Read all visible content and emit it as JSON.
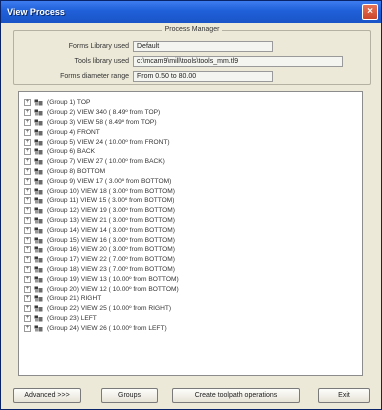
{
  "window": {
    "title": "View Process",
    "close_glyph": "×"
  },
  "manager": {
    "legend": "Process Manager",
    "fields": [
      {
        "label": "Forms Library used",
        "value": "Default"
      },
      {
        "label": "Tools library used",
        "value": "c:\\mcam9\\mill\\tools\\tools_mm.tl9"
      },
      {
        "label": "Forms diameter range",
        "value": "From 0.50 to 80.00"
      }
    ]
  },
  "tree": {
    "expander_glyph": "+",
    "items": [
      "(Group 1) TOP",
      "(Group 2) VIEW 340 ( 8.49º from TOP)",
      "(Group 3) VIEW 58 ( 8.49º from TOP)",
      "(Group 4) FRONT",
      "(Group 5) VIEW 24 ( 10.00º from FRONT)",
      "(Group 6) BACK",
      "(Group 7) VIEW 27 ( 10.00º from BACK)",
      "(Group 8) BOTTOM",
      "(Group 9) VIEW 17 ( 3.00º from BOTTOM)",
      "(Group 10) VIEW 18 ( 3.00º from BOTTOM)",
      "(Group 11) VIEW 15 ( 3.00º from BOTTOM)",
      "(Group 12) VIEW 19 ( 3.00º from BOTTOM)",
      "(Group 13) VIEW 21 ( 3.00º from BOTTOM)",
      "(Group 14) VIEW 14 ( 3.00º from BOTTOM)",
      "(Group 15) VIEW 16 ( 3.00º from BOTTOM)",
      "(Group 16) VIEW 20 ( 3.00º from BOTTOM)",
      "(Group 17) VIEW 22 ( 7.00º from BOTTOM)",
      "(Group 18) VIEW 23 ( 7.00º from BOTTOM)",
      "(Group 19) VIEW 13 ( 10.00º from BOTTOM)",
      "(Group 20) VIEW 12 ( 10.00º from BOTTOM)",
      "(Group 21) RIGHT",
      "(Group 22) VIEW 25 ( 10.00º from RIGHT)",
      "(Group 23) LEFT",
      "(Group 24) VIEW 26 ( 10.00º from LEFT)"
    ]
  },
  "buttons": {
    "advanced": "Advanced >>>",
    "groups": "Groups",
    "create": "Create toolpath operations",
    "exit": "Exit"
  },
  "colors": {
    "titlebar": "#1f5fd8",
    "close": "#c9452a",
    "window_bg": "#ece9d8",
    "tree_bg": "#ffffff"
  }
}
